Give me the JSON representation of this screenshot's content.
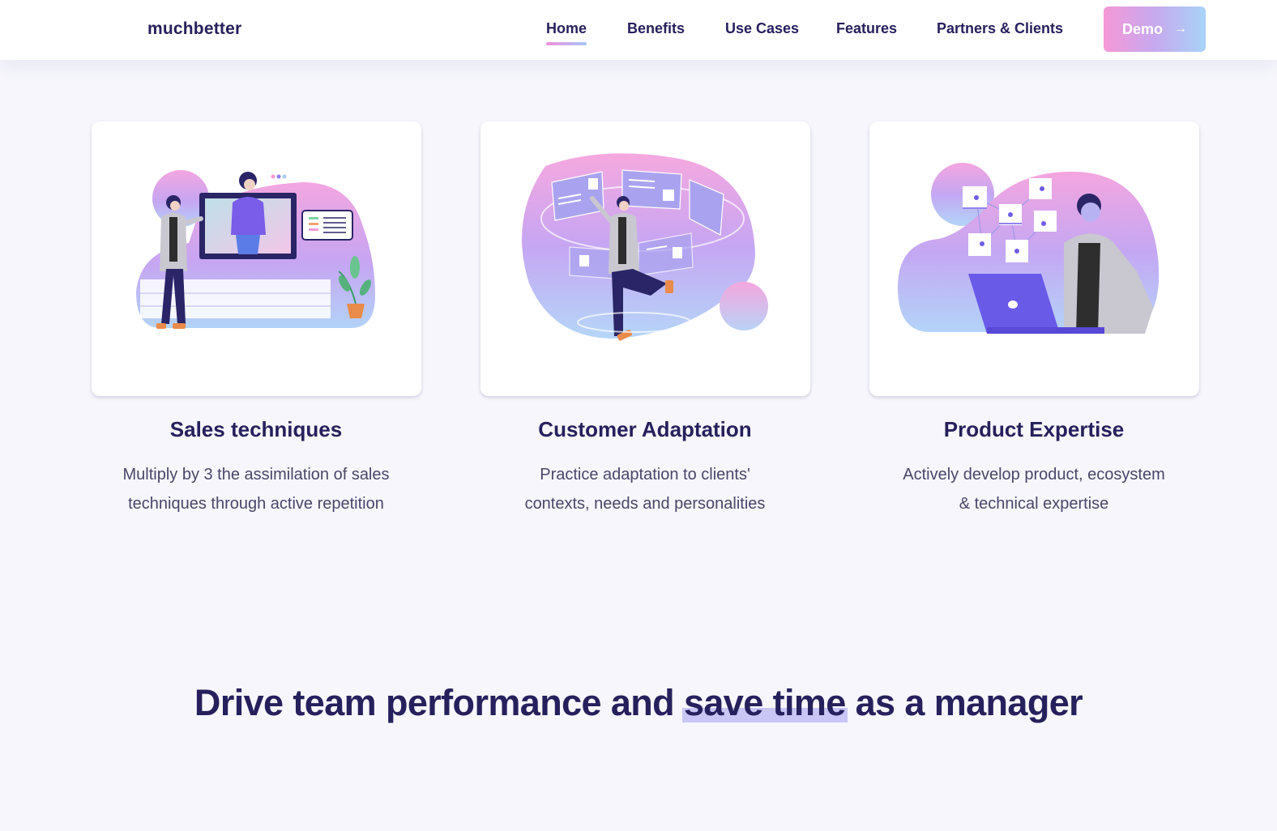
{
  "brand": {
    "name": "muchbetter"
  },
  "nav": {
    "items": [
      {
        "label": "Home",
        "active": true
      },
      {
        "label": "Benefits",
        "active": false
      },
      {
        "label": "Use Cases",
        "active": false
      },
      {
        "label": "Features",
        "active": false
      },
      {
        "label": "Partners & Clients",
        "active": false
      }
    ],
    "demo": {
      "label": "Demo",
      "icon": "arrow-right-icon"
    }
  },
  "cards": [
    {
      "title": "Sales techniques",
      "line1": "Multiply by 3 the assimilation of sales",
      "line2": "techniques through active repetition"
    },
    {
      "title": "Customer Adaptation",
      "line1": "Practice adaptation to clients'",
      "line2": "contexts, needs and personalities"
    },
    {
      "title": "Product Expertise",
      "line1": "Actively develop product, ecosystem",
      "line2": "& technical expertise"
    }
  ],
  "headline": {
    "before": "Drive team performance and",
    "highlight": "save time",
    "after": "as a manager"
  },
  "colors": {
    "navy": "#26215c",
    "accent_pink": "#f28fd9",
    "accent_blue": "#a7c8f7",
    "highlight": "#c9c6f6",
    "background": "#f6f6fc"
  }
}
